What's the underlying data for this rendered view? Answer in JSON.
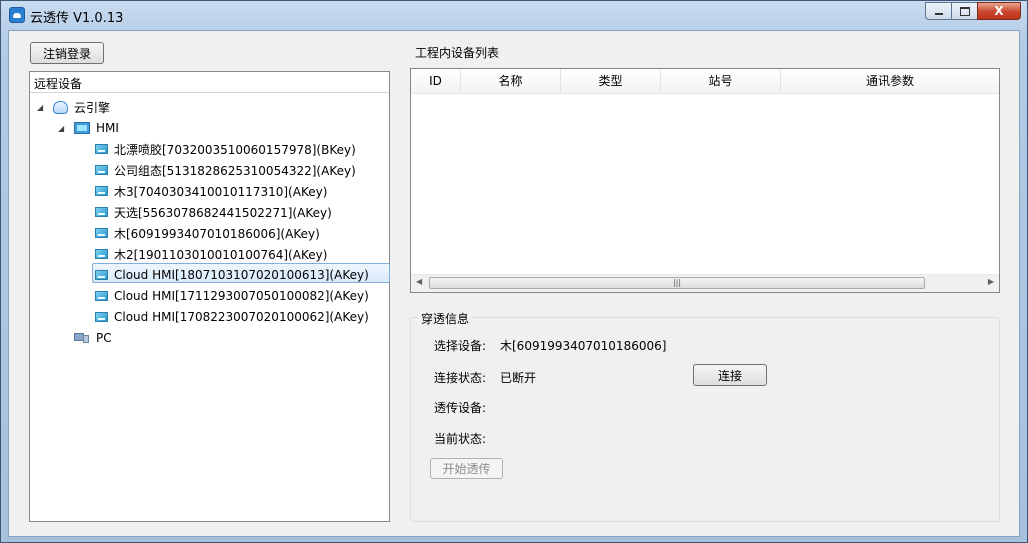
{
  "window": {
    "title": "云透传 V1.0.13",
    "min_label": "",
    "max_label": "",
    "close_label": "X"
  },
  "toolbar": {
    "logout_label": "注销登录"
  },
  "tree": {
    "header": "远程设备",
    "root": {
      "label": "云引擎"
    },
    "hmi": {
      "label": "HMI"
    },
    "devices": [
      "北漂喷胶[703200351006015797​8](BKey)",
      "公司组态[513182862531005432​2](AKey)",
      "木3[704030341001011731​0](AKey)",
      "天选[556307868244150227​1](AKey)",
      "木[609199340701018600​6](AKey)",
      "木2[190110301001010076​4](AKey)",
      "Cloud HMI[180710310702010061​3](AKey)",
      "Cloud HMI[171129300705010008​2](AKey)",
      "Cloud HMI[170822300702010006​2](AKey)"
    ],
    "selected_index": 4,
    "pc": {
      "label": "PC"
    }
  },
  "device_list": {
    "title": "工程内设备列表",
    "columns": [
      "ID",
      "名称",
      "类型",
      "站号",
      "通讯参数"
    ],
    "rows": []
  },
  "passthrough": {
    "title": "穿透信息",
    "selected_device_label": "选择设备:",
    "selected_device_value": "木[6091993407010186006]",
    "connection_status_label": "连接状态:",
    "connection_status_value": "已断开",
    "connect_label": "连接",
    "passthrough_device_label": "透传设备:",
    "passthrough_device_value": "",
    "current_status_label": "当前状态:",
    "current_status_value": "",
    "start_label": "开始透传"
  }
}
